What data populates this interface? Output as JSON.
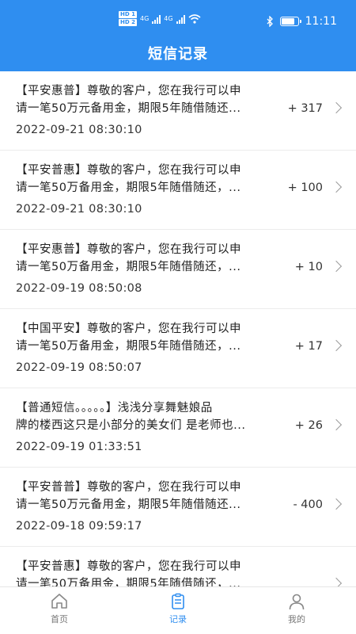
{
  "status_bar": {
    "hd1": "HD 1",
    "hd2": "HD 2",
    "net1": "4G",
    "net2": "4G",
    "time": "11:11",
    "icons": [
      "bluetooth-icon",
      "battery-icon",
      "wifi-icon",
      "signal-icon"
    ],
    "battery_level": 0.8
  },
  "header": {
    "title": "短信记录",
    "color": "#2f8ef0"
  },
  "messages": [
    {
      "line1": "【平安惠普】尊敬的客户，您在我行可以申",
      "line2": "请一笔50万元备用金，期限5年随借随还...",
      "time": "2022-09-21 08:30:10",
      "amount": "+ 317"
    },
    {
      "line1": "【平安普惠】尊敬的客户，您在我行可以申",
      "line2": "请一笔50万备用金，期限5年随借随还，...",
      "time": "2022-09-21 08:30:10",
      "amount": "+ 100"
    },
    {
      "line1": "【平安惠普】尊敬的客户，您在我行可以申",
      "line2": "请一笔50万备用金，期限5年随借随还，...",
      "time": "2022-09-19 08:50:08",
      "amount": "+ 10"
    },
    {
      "line1": "【中国平安】尊敬的客户，您在我行可以申",
      "line2": "请一笔50万备用金，期限5年随借随还，...",
      "time": "2022-09-19 08:50:07",
      "amount": "+ 17"
    },
    {
      "line1": "【普通短信。。。。。】浅浅分享舞魅娘品",
      "line2": "牌的楼西这只是小部分的美女们 是老师也...",
      "time": "2022-09-19 01:33:51",
      "amount": "+ 26"
    },
    {
      "line1": "【平安普普】尊敬的客户，您在我行可以申",
      "line2": "请一笔50万元备用金，期限5年随借随还...",
      "time": "2022-09-18 09:59:17",
      "amount": "- 400"
    },
    {
      "line1": "【平安普惠】尊敬的客户，您在我行可以申",
      "line2": "请一笔50万备用金，期限5年随借随还，...",
      "time": "",
      "amount": ""
    }
  ],
  "tabs": [
    {
      "label": "首页",
      "icon": "home-icon",
      "active": false
    },
    {
      "label": "记录",
      "icon": "record-icon",
      "active": true
    },
    {
      "label": "我的",
      "icon": "profile-icon",
      "active": false
    }
  ]
}
